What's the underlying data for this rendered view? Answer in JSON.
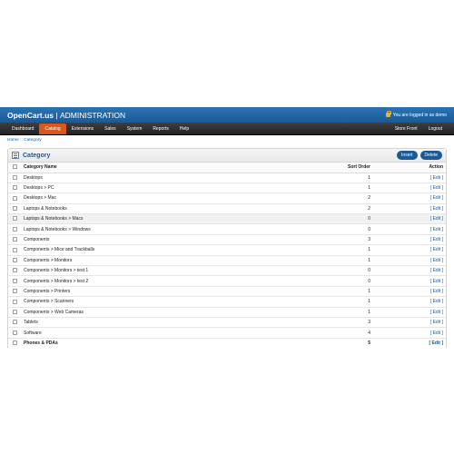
{
  "header": {
    "brand": "OpenCart.us",
    "brand_sep": "|",
    "brand_suffix": "ADMINISTRATION",
    "login_text": "You are logged in as demo"
  },
  "nav": {
    "left": [
      "Dashboard",
      "Catalog",
      "Extensions",
      "Sales",
      "System",
      "Reports",
      "Help"
    ],
    "right": [
      "Store Front",
      "Logout"
    ],
    "active": "Catalog"
  },
  "breadcrumb": [
    "Home",
    "Category"
  ],
  "breadcrumb_sep": "::",
  "panel": {
    "title": "Category",
    "insert_label": "Insert",
    "delete_label": "Delete"
  },
  "table": {
    "headers": [
      "Category Name",
      "Sort Order",
      "Action"
    ],
    "edit_label": "[ Edit ]",
    "rows": [
      {
        "name": "Desktops",
        "order": "1"
      },
      {
        "name": "Desktops > PC",
        "order": "1"
      },
      {
        "name": "Desktops > Mac",
        "order": "2"
      },
      {
        "name": "Laptops & Notebooks",
        "order": "2"
      },
      {
        "name": "Laptops & Notebooks > Macs",
        "order": "0"
      },
      {
        "name": "Laptops & Notebooks > Windows",
        "order": "0"
      },
      {
        "name": "Components",
        "order": "3"
      },
      {
        "name": "Components > Mice and Trackballs",
        "order": "1"
      },
      {
        "name": "Components > Monitors",
        "order": "1"
      },
      {
        "name": "Components > Monitors > test 1",
        "order": "0"
      },
      {
        "name": "Components > Monitors > test 2",
        "order": "0"
      },
      {
        "name": "Components > Printers",
        "order": "1"
      },
      {
        "name": "Components > Scanners",
        "order": "1"
      },
      {
        "name": "Components > Web Cameras",
        "order": "1"
      },
      {
        "name": "Tablets",
        "order": "3"
      },
      {
        "name": "Software",
        "order": "4"
      },
      {
        "name": "Phones & PDAs",
        "order": "5"
      }
    ]
  },
  "colors": {
    "header_blue": "#1b5a96",
    "nav_active": "#d9561d",
    "nav_dark": "#222222"
  }
}
